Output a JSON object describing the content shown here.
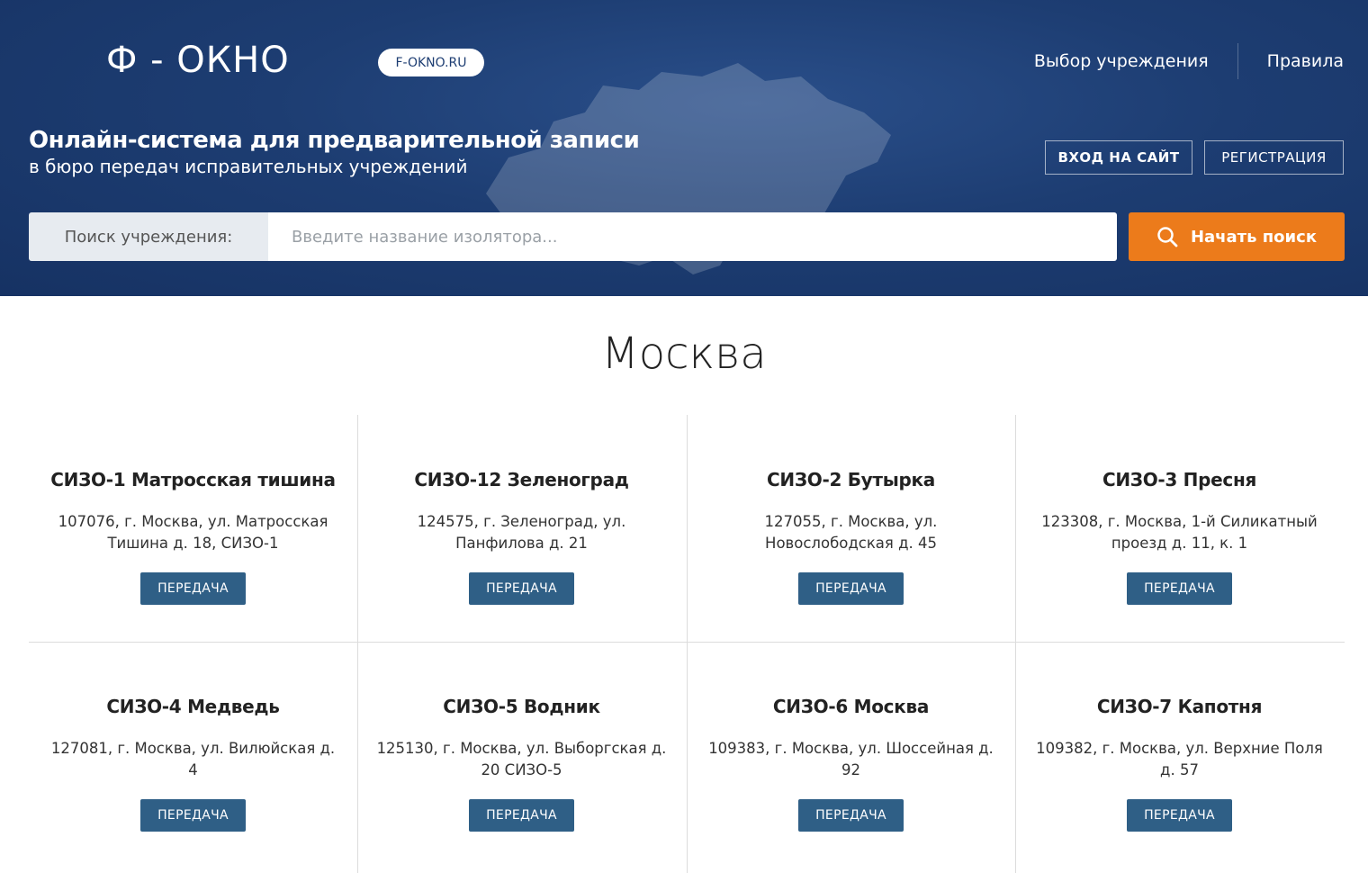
{
  "header": {
    "logo_text": "Ф - ОКНО",
    "domain_pill": "F-OKNO.RU",
    "nav": [
      {
        "label": "Выбор учреждения"
      },
      {
        "label": "Правила"
      }
    ],
    "tagline_title": "Онлайн-система для предварительной записи",
    "tagline_subtitle": "в бюро передач исправительных учреждений",
    "login_label": "ВХОД НА САЙТ",
    "register_label": "РЕГИСТРАЦИЯ"
  },
  "search": {
    "label": "Поиск учреждения:",
    "placeholder": "Введите название изолятора...",
    "value": "",
    "button_label": "Начать поиск"
  },
  "city": "Москва",
  "institutions": [
    {
      "name": "СИЗО-1 Матросская тишина",
      "address": "107076, г. Москва, ул. Матросская Тишина д. 18, СИЗО-1",
      "button": "ПЕРЕДАЧА"
    },
    {
      "name": "СИЗО-12 Зеленоград",
      "address": "124575, г. Зеленоград, ул. Панфилова д. 21",
      "button": "ПЕРЕДАЧА"
    },
    {
      "name": "СИЗО-2 Бутырка",
      "address": "127055, г. Москва, ул. Новослободская д. 45",
      "button": "ПЕРЕДАЧА"
    },
    {
      "name": "СИЗО-3 Пресня",
      "address": "123308, г. Москва, 1-й Силикатный проезд д. 11, к. 1",
      "button": "ПЕРЕДАЧА"
    },
    {
      "name": "СИЗО-4 Медведь",
      "address": "127081, г. Москва, ул. Вилюйская д. 4",
      "button": "ПЕРЕДАЧА"
    },
    {
      "name": "СИЗО-5 Водник",
      "address": "125130, г. Москва, ул. Выборгская д. 20 СИЗО-5",
      "button": "ПЕРЕДАЧА"
    },
    {
      "name": "СИЗО-6 Москва",
      "address": "109383, г. Москва, ул. Шоссейная д. 92",
      "button": "ПЕРЕДАЧА"
    },
    {
      "name": "СИЗО-7 Капотня",
      "address": "109382, г. Москва, ул. Верхние Поля д. 57",
      "button": "ПЕРЕДАЧА"
    }
  ],
  "colors": {
    "hero_bg": "#1d3d72",
    "accent_orange": "#ec7b1b",
    "button_blue": "#2f5f86"
  }
}
